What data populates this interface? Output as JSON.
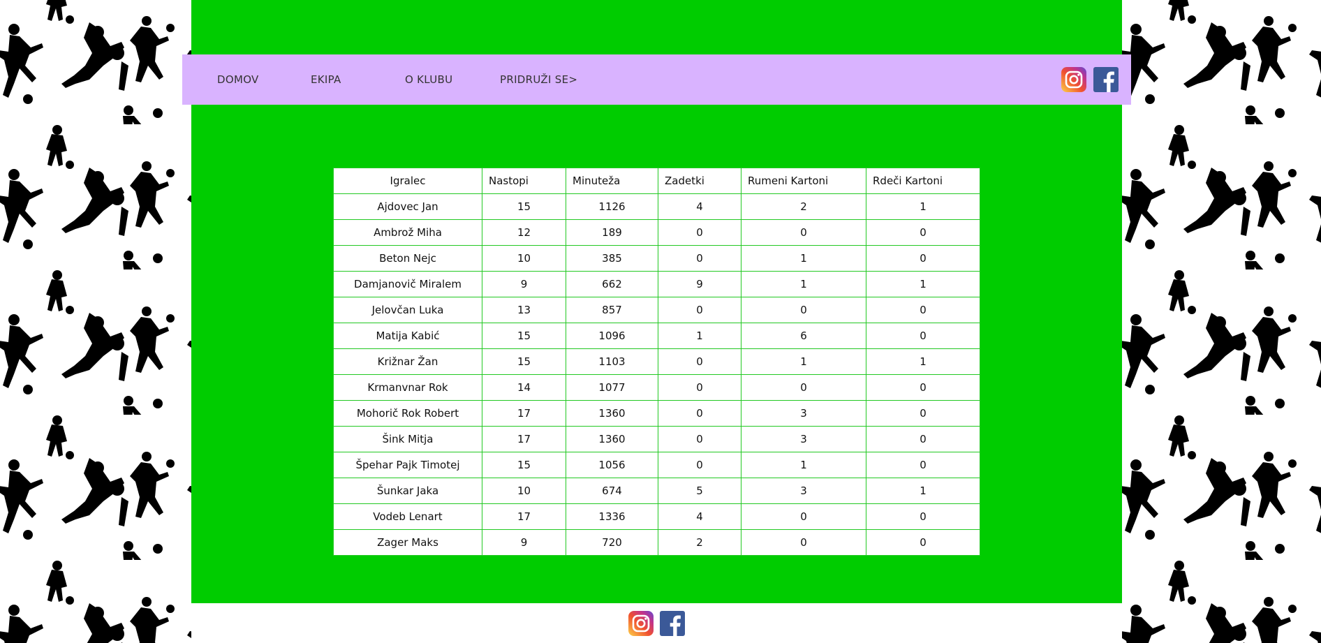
{
  "colors": {
    "main_background": "#00cc00",
    "navbar_background": "#d9b3ff",
    "table_border": "#22c922",
    "page_background": "#ffffff",
    "pattern_color": "#000000"
  },
  "nav": {
    "items": [
      {
        "label": "DOMOV"
      },
      {
        "label": "EKIPA"
      },
      {
        "label": "O KLUBU"
      },
      {
        "label": "PRIDRUŽI SE>"
      }
    ],
    "social": [
      "instagram-icon",
      "facebook-icon"
    ]
  },
  "footer": {
    "social": [
      "instagram-icon",
      "facebook-icon"
    ]
  },
  "table": {
    "headers": {
      "player": "Igralec",
      "appearances": "Nastopi",
      "minutes": "Minuteža",
      "goals": "Zadetki",
      "yellow": "Rumeni Kartoni",
      "red": "Rdeči Kartoni"
    },
    "rows": [
      {
        "player": "Ajdovec Jan",
        "appearances": "15",
        "minutes": "1126",
        "goals": "4",
        "yellow": "2",
        "red": "1"
      },
      {
        "player": "Ambrož Miha",
        "appearances": "12",
        "minutes": "189",
        "goals": "0",
        "yellow": "0",
        "red": "0"
      },
      {
        "player": "Beton Nejc",
        "appearances": "10",
        "minutes": "385",
        "goals": "0",
        "yellow": "1",
        "red": "0"
      },
      {
        "player": "Damjanovič Miralem",
        "appearances": "9",
        "minutes": "662",
        "goals": "9",
        "yellow": "1",
        "red": "1"
      },
      {
        "player": "Jelovčan Luka",
        "appearances": "13",
        "minutes": "857",
        "goals": "0",
        "yellow": "0",
        "red": "0"
      },
      {
        "player": "Matija Kabić",
        "appearances": "15",
        "minutes": "1096",
        "goals": "1",
        "yellow": "6",
        "red": "0"
      },
      {
        "player": "Križnar Žan",
        "appearances": "15",
        "minutes": "1103",
        "goals": "0",
        "yellow": "1",
        "red": "1"
      },
      {
        "player": "Krmanvnar Rok",
        "appearances": "14",
        "minutes": "1077",
        "goals": "0",
        "yellow": "0",
        "red": "0"
      },
      {
        "player": "Mohorič Rok Robert",
        "appearances": "17",
        "minutes": "1360",
        "goals": "0",
        "yellow": "3",
        "red": "0"
      },
      {
        "player": "Šink Mitja",
        "appearances": "17",
        "minutes": "1360",
        "goals": "0",
        "yellow": "3",
        "red": "0"
      },
      {
        "player": "Špehar Pajk Timotej",
        "appearances": "15",
        "minutes": "1056",
        "goals": "0",
        "yellow": "1",
        "red": "0"
      },
      {
        "player": "Šunkar Jaka",
        "appearances": "10",
        "minutes": "674",
        "goals": "5",
        "yellow": "3",
        "red": "1"
      },
      {
        "player": "Vodeb Lenart",
        "appearances": "17",
        "minutes": "1336",
        "goals": "4",
        "yellow": "0",
        "red": "0"
      },
      {
        "player": "Zager Maks",
        "appearances": "9",
        "minutes": "720",
        "goals": "2",
        "yellow": "0",
        "red": "0"
      }
    ]
  }
}
